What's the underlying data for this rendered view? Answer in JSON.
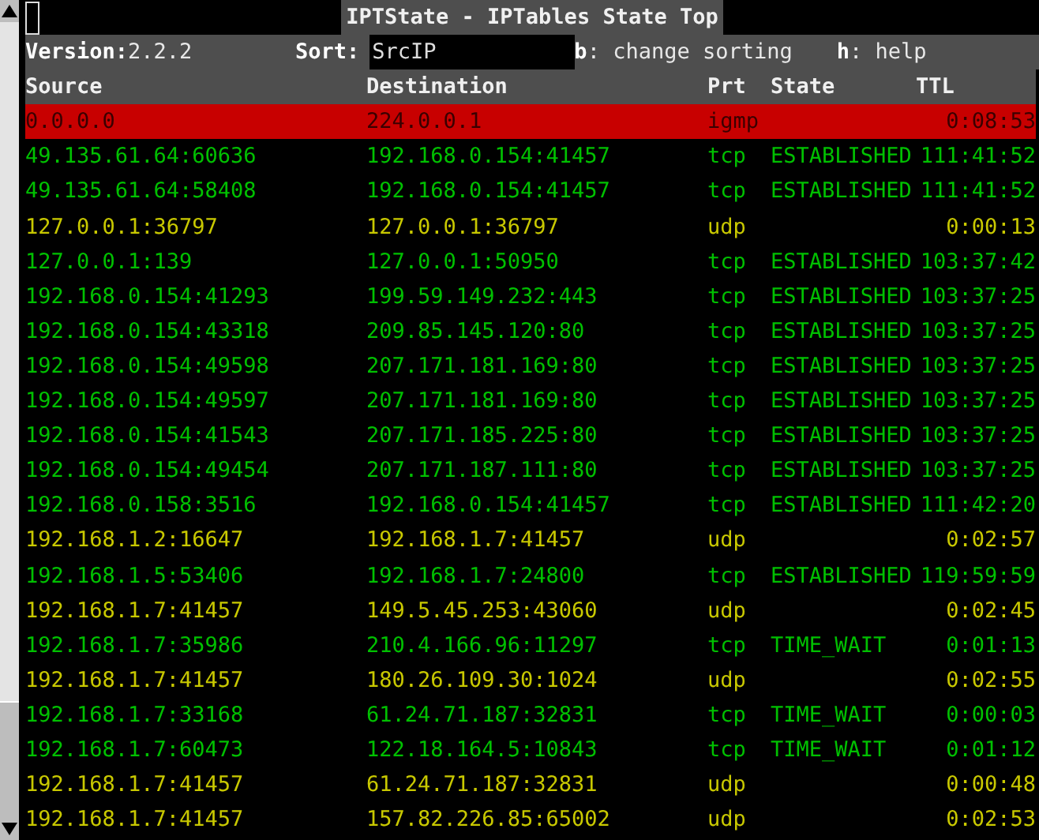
{
  "title": "IPTState - IPTables State Top",
  "status_line": {
    "version_label": "Version:",
    "version": "2.2.2",
    "sort_label": "Sort:",
    "sort": "SrcIP",
    "keys": [
      {
        "key": "b",
        "text": ": change sorting"
      },
      {
        "key": "h",
        "text": ": help"
      }
    ]
  },
  "columns": [
    "Source",
    "Destination",
    "Prt",
    "State",
    "TTL"
  ],
  "rows": [
    {
      "source": "0.0.0.0",
      "destination": "224.0.0.1",
      "protocol": "igmp",
      "ttl": "0:08:53",
      "color": "#c80000",
      "selected": true
    },
    {
      "source": "49.135.61.64:60636",
      "destination": "192.168.0.154:41457",
      "protocol": "tcp",
      "state": "ESTABLISHED",
      "ttl": "111:41:52",
      "color": "#00c000",
      "selected": false
    },
    {
      "source": "49.135.61.64:58408",
      "destination": "192.168.0.154:41457",
      "protocol": "tcp",
      "state": "ESTABLISHED",
      "ttl": "111:41:52",
      "color": "#00c000",
      "selected": false
    },
    {
      "source": "127.0.0.1:36797",
      "destination": "127.0.0.1:36797",
      "protocol": "udp",
      "ttl": "0:00:13",
      "color": "#c8c800",
      "selected": false
    },
    {
      "source": "127.0.0.1:139",
      "destination": "127.0.0.1:50950",
      "protocol": "tcp",
      "state": "ESTABLISHED",
      "ttl": "103:37:42",
      "color": "#00c000",
      "selected": false
    },
    {
      "source": "192.168.0.154:41293",
      "destination": "199.59.149.232:443",
      "protocol": "tcp",
      "state": "ESTABLISHED",
      "ttl": "103:37:25",
      "color": "#00c000",
      "selected": false
    },
    {
      "source": "192.168.0.154:43318",
      "destination": "209.85.145.120:80",
      "protocol": "tcp",
      "state": "ESTABLISHED",
      "ttl": "103:37:25",
      "color": "#00c000",
      "selected": false
    },
    {
      "source": "192.168.0.154:49598",
      "destination": "207.171.181.169:80",
      "protocol": "tcp",
      "state": "ESTABLISHED",
      "ttl": "103:37:25",
      "color": "#00c000",
      "selected": false
    },
    {
      "source": "192.168.0.154:49597",
      "destination": "207.171.181.169:80",
      "protocol": "tcp",
      "state": "ESTABLISHED",
      "ttl": "103:37:25",
      "color": "#00c000",
      "selected": false
    },
    {
      "source": "192.168.0.154:41543",
      "destination": "207.171.185.225:80",
      "protocol": "tcp",
      "state": "ESTABLISHED",
      "ttl": "103:37:25",
      "color": "#00c000",
      "selected": false
    },
    {
      "source": "192.168.0.154:49454",
      "destination": "207.171.187.111:80",
      "protocol": "tcp",
      "state": "ESTABLISHED",
      "ttl": "103:37:25",
      "color": "#00c000",
      "selected": false
    },
    {
      "source": "192.168.0.158:3516",
      "destination": "192.168.0.154:41457",
      "protocol": "tcp",
      "state": "ESTABLISHED",
      "ttl": "111:42:20",
      "color": "#00c000",
      "selected": false
    },
    {
      "source": "192.168.1.2:16647",
      "destination": "192.168.1.7:41457",
      "protocol": "udp",
      "ttl": "0:02:57",
      "color": "#c8c800",
      "selected": false
    },
    {
      "source": "192.168.1.5:53406",
      "destination": "192.168.1.7:24800",
      "protocol": "tcp",
      "state": "ESTABLISHED",
      "ttl": "119:59:59",
      "color": "#00c000",
      "selected": false
    },
    {
      "source": "192.168.1.7:41457",
      "destination": "149.5.45.253:43060",
      "protocol": "udp",
      "ttl": "0:02:45",
      "color": "#c8c800",
      "selected": false
    },
    {
      "source": "192.168.1.7:35986",
      "destination": "210.4.166.96:11297",
      "protocol": "tcp",
      "state": "TIME_WAIT",
      "ttl": "0:01:13",
      "color": "#00c000",
      "selected": false
    },
    {
      "source": "192.168.1.7:41457",
      "destination": "180.26.109.30:1024",
      "protocol": "udp",
      "ttl": "0:02:55",
      "color": "#c8c800",
      "selected": false
    },
    {
      "source": "192.168.1.7:33168",
      "destination": "61.24.71.187:32831",
      "protocol": "tcp",
      "state": "TIME_WAIT",
      "ttl": "0:00:03",
      "color": "#00c000",
      "selected": false
    },
    {
      "source": "192.168.1.7:60473",
      "destination": "122.18.164.5:10843",
      "protocol": "tcp",
      "state": "TIME_WAIT",
      "ttl": "0:01:12",
      "color": "#00c000",
      "selected": false
    },
    {
      "source": "192.168.1.7:41457",
      "destination": "61.24.71.187:32831",
      "protocol": "udp",
      "ttl": "0:00:48",
      "color": "#c8c800",
      "selected": false
    },
    {
      "source": "192.168.1.7:41457",
      "destination": "157.82.226.85:65002",
      "protocol": "udp",
      "ttl": "0:02:53",
      "color": "#c8c800",
      "selected": false
    }
  ]
}
